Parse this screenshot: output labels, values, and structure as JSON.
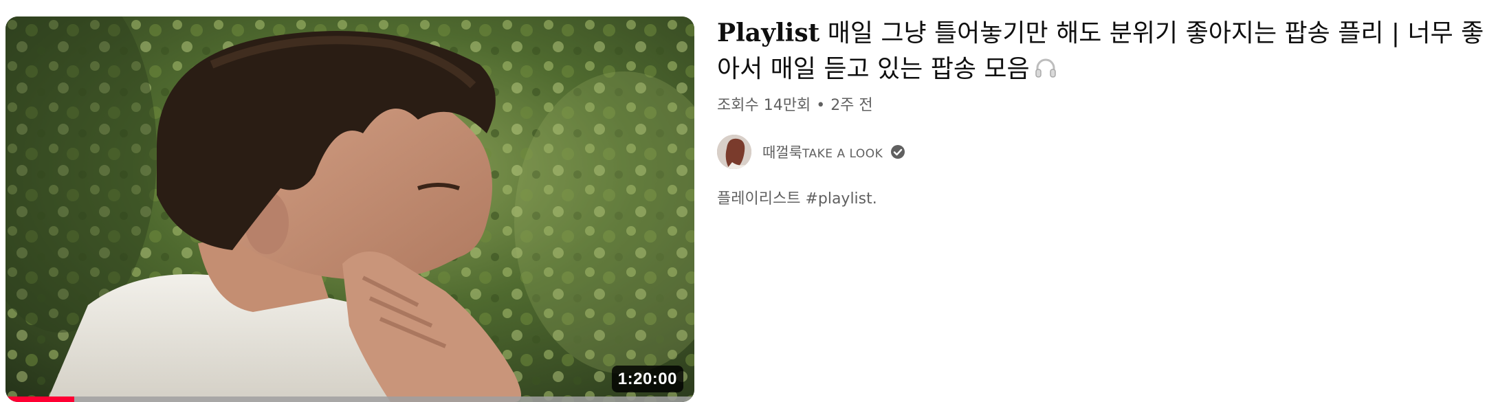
{
  "video": {
    "duration": "1:20:00",
    "watch_progress": 0.1,
    "title_lead": "Playlist",
    "title_rest": " 매일 그냥 틀어놓기만 해도 분위기 좋아지는 팝송 플리 | 너무 좋아서 매일 듣고 있는 팝송 모음",
    "title_icon": "headphones-icon",
    "views": "조회수 14만회",
    "separator": "•",
    "age": "2주 전",
    "channel_name_ko": "때껄룩",
    "channel_name_en": "TAKE A LOOK",
    "channel_verified_icon": "verified-check-icon",
    "description_text": "플레이리스트 ",
    "description_tag": "#playlist",
    "description_end": "."
  },
  "colors": {
    "progress": "#ff0033",
    "meta_text": "#606060",
    "title_text": "#0f0f0f"
  }
}
